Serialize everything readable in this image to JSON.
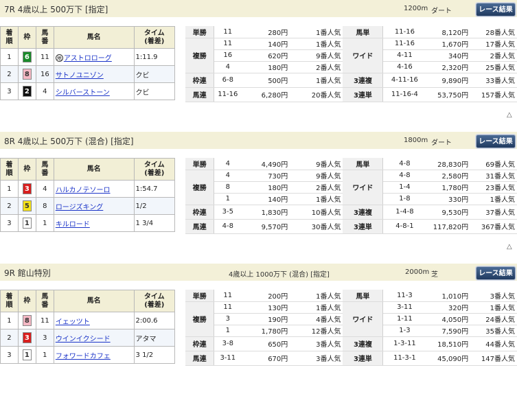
{
  "races": [
    {
      "id": "7R",
      "title": "7R 4歳以上 500万下 [指定]",
      "cond": "",
      "dist": "1200m",
      "surface": "ダート",
      "btn": "レース結果",
      "head": {
        "rank": "着\n順",
        "waku": "枠",
        "uma": "馬\n番",
        "name": "馬名",
        "time": "タイム\n(着差)"
      },
      "horses": [
        {
          "rank": "1",
          "waku": "6",
          "uma": "11",
          "name": "アストロローグ",
          "mark": "地",
          "time": "1:11.9",
          "color": "#1a8a2a",
          "fg": "#fff"
        },
        {
          "rank": "2",
          "waku": "8",
          "uma": "16",
          "name": "サトノユニゾン",
          "time": "クビ",
          "color": "#f4b8c4",
          "fg": "#333"
        },
        {
          "rank": "3",
          "waku": "2",
          "uma": "4",
          "name": "シルバーストーン",
          "time": "クビ",
          "color": "#111",
          "fg": "#fff"
        }
      ],
      "payout": [
        {
          "k1": "単勝",
          "rows": [
            {
              "n": "11",
              "y": "280円",
              "p": "1番人気"
            }
          ],
          "k2": "馬単",
          "rows2": [
            {
              "n": "11-16",
              "y": "8,120円",
              "p": "28番人気"
            }
          ]
        },
        {
          "k1": "複勝",
          "rows": [
            {
              "n": "11",
              "y": "140円",
              "p": "1番人気"
            },
            {
              "n": "16",
              "y": "620円",
              "p": "9番人気"
            },
            {
              "n": "4",
              "y": "180円",
              "p": "2番人気"
            }
          ],
          "k2": "ワイド",
          "rows2": [
            {
              "n": "11-16",
              "y": "1,670円",
              "p": "17番人気"
            },
            {
              "n": "4-11",
              "y": "340円",
              "p": "2番人気"
            },
            {
              "n": "4-16",
              "y": "2,320円",
              "p": "25番人気"
            }
          ]
        },
        {
          "k1": "枠連",
          "rows": [
            {
              "n": "6-8",
              "y": "500円",
              "p": "1番人気"
            }
          ],
          "k2": "3連複",
          "rows2": [
            {
              "n": "4-11-16",
              "y": "9,890円",
              "p": "33番人気"
            }
          ]
        },
        {
          "k1": "馬連",
          "rows": [
            {
              "n": "11-16",
              "y": "6,280円",
              "p": "20番人気"
            }
          ],
          "k2": "3連単",
          "rows2": [
            {
              "n": "11-16-4",
              "y": "53,750円",
              "p": "157番人気"
            }
          ]
        }
      ]
    },
    {
      "id": "8R",
      "title": "8R 4歳以上 500万下 (混合) [指定]",
      "cond": "",
      "dist": "1800m",
      "surface": "ダート",
      "btn": "レース結果",
      "head": {
        "rank": "着\n順",
        "waku": "枠",
        "uma": "馬\n番",
        "name": "馬名",
        "time": "タイム\n(着差)"
      },
      "horses": [
        {
          "rank": "1",
          "waku": "3",
          "uma": "4",
          "name": "ハルカノテソーロ",
          "time": "1:54.7",
          "color": "#d81e1e",
          "fg": "#fff"
        },
        {
          "rank": "2",
          "waku": "5",
          "uma": "8",
          "name": "ロージズキング",
          "time": "1/2",
          "color": "#f4e21a",
          "fg": "#333"
        },
        {
          "rank": "3",
          "waku": "1",
          "uma": "1",
          "name": "キルロード",
          "time": "1 3/4",
          "color": "#fff",
          "fg": "#333"
        }
      ],
      "payout": [
        {
          "k1": "単勝",
          "rows": [
            {
              "n": "4",
              "y": "4,490円",
              "p": "9番人気"
            }
          ],
          "k2": "馬単",
          "rows2": [
            {
              "n": "4-8",
              "y": "28,830円",
              "p": "69番人気"
            }
          ]
        },
        {
          "k1": "複勝",
          "rows": [
            {
              "n": "4",
              "y": "730円",
              "p": "9番人気"
            },
            {
              "n": "8",
              "y": "180円",
              "p": "2番人気"
            },
            {
              "n": "1",
              "y": "140円",
              "p": "1番人気"
            }
          ],
          "k2": "ワイド",
          "rows2": [
            {
              "n": "4-8",
              "y": "2,580円",
              "p": "31番人気"
            },
            {
              "n": "1-4",
              "y": "1,780円",
              "p": "23番人気"
            },
            {
              "n": "1-8",
              "y": "330円",
              "p": "1番人気"
            }
          ]
        },
        {
          "k1": "枠連",
          "rows": [
            {
              "n": "3-5",
              "y": "1,830円",
              "p": "10番人気"
            }
          ],
          "k2": "3連複",
          "rows2": [
            {
              "n": "1-4-8",
              "y": "9,530円",
              "p": "37番人気"
            }
          ]
        },
        {
          "k1": "馬連",
          "rows": [
            {
              "n": "4-8",
              "y": "9,570円",
              "p": "30番人気"
            }
          ],
          "k2": "3連単",
          "rows2": [
            {
              "n": "4-8-1",
              "y": "117,820円",
              "p": "367番人気"
            }
          ]
        }
      ]
    },
    {
      "id": "9R",
      "title": "9R 館山特別",
      "cond": "4歳以上 1000万下 (混合) [指定]",
      "dist": "2000m",
      "surface": "芝",
      "btn": "レース結果",
      "head": {
        "rank": "着\n順",
        "waku": "枠",
        "uma": "馬\n番",
        "name": "馬名",
        "time": "タイム\n(着差)"
      },
      "horses": [
        {
          "rank": "1",
          "waku": "8",
          "uma": "11",
          "name": "イェッツト",
          "time": "2:00.6",
          "color": "#f4b8c4",
          "fg": "#333"
        },
        {
          "rank": "2",
          "waku": "3",
          "uma": "3",
          "name": "ウインイクシード",
          "time": "アタマ",
          "color": "#d81e1e",
          "fg": "#fff"
        },
        {
          "rank": "3",
          "waku": "1",
          "uma": "1",
          "name": "フォワードカフェ",
          "time": "3 1/2",
          "color": "#fff",
          "fg": "#333"
        }
      ],
      "payout": [
        {
          "k1": "単勝",
          "rows": [
            {
              "n": "11",
              "y": "200円",
              "p": "1番人気"
            }
          ],
          "k2": "馬単",
          "rows2": [
            {
              "n": "11-3",
              "y": "1,010円",
              "p": "3番人気"
            }
          ]
        },
        {
          "k1": "複勝",
          "rows": [
            {
              "n": "11",
              "y": "130円",
              "p": "1番人気"
            },
            {
              "n": "3",
              "y": "190円",
              "p": "4番人気"
            },
            {
              "n": "1",
              "y": "1,780円",
              "p": "12番人気"
            }
          ],
          "k2": "ワイド",
          "rows2": [
            {
              "n": "3-11",
              "y": "320円",
              "p": "1番人気"
            },
            {
              "n": "1-11",
              "y": "4,050円",
              "p": "24番人気"
            },
            {
              "n": "1-3",
              "y": "7,590円",
              "p": "35番人気"
            }
          ]
        },
        {
          "k1": "枠連",
          "rows": [
            {
              "n": "3-8",
              "y": "650円",
              "p": "3番人気"
            }
          ],
          "k2": "3連複",
          "rows2": [
            {
              "n": "1-3-11",
              "y": "18,510円",
              "p": "44番人気"
            }
          ]
        },
        {
          "k1": "馬連",
          "rows": [
            {
              "n": "3-11",
              "y": "670円",
              "p": "3番人気"
            }
          ],
          "k2": "3連単",
          "rows2": [
            {
              "n": "11-3-1",
              "y": "45,090円",
              "p": "147番人気"
            }
          ]
        }
      ]
    }
  ],
  "up_arrow": "△"
}
